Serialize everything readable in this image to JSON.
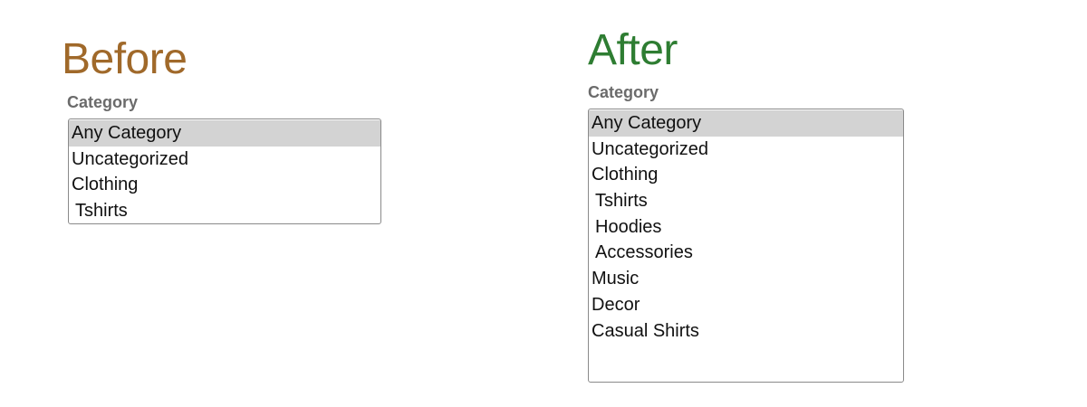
{
  "colors": {
    "before_heading": "#a0692a",
    "after_heading": "#2e7d32",
    "label": "#6b6b6b",
    "selected_bg": "#d3d3d3",
    "border": "#8a8a8a"
  },
  "before": {
    "heading": "Before",
    "label": "Category",
    "options": [
      {
        "text": "Any Category",
        "selected": true,
        "indent": false
      },
      {
        "text": "Uncategorized",
        "selected": false,
        "indent": false
      },
      {
        "text": "Clothing",
        "selected": false,
        "indent": false
      },
      {
        "text": "Tshirts",
        "selected": false,
        "indent": true
      }
    ]
  },
  "after": {
    "heading": "After",
    "label": "Category",
    "options": [
      {
        "text": "Any Category",
        "selected": true,
        "indent": false
      },
      {
        "text": "Uncategorized",
        "selected": false,
        "indent": false
      },
      {
        "text": "Clothing",
        "selected": false,
        "indent": false
      },
      {
        "text": "Tshirts",
        "selected": false,
        "indent": true
      },
      {
        "text": "Hoodies",
        "selected": false,
        "indent": true
      },
      {
        "text": "Accessories",
        "selected": false,
        "indent": true
      },
      {
        "text": "Music",
        "selected": false,
        "indent": false
      },
      {
        "text": "Decor",
        "selected": false,
        "indent": false
      },
      {
        "text": "Casual Shirts",
        "selected": false,
        "indent": false
      }
    ]
  }
}
